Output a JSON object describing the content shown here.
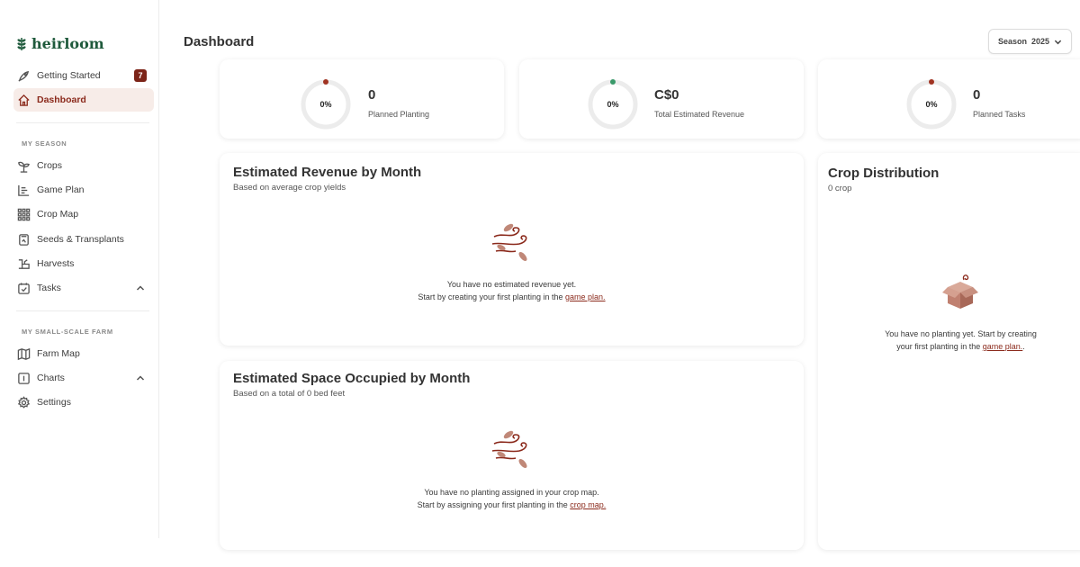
{
  "app": {
    "name": "heirloom"
  },
  "sidebar": {
    "getting_started": {
      "label": "Getting Started",
      "badge": "7"
    },
    "dashboard": {
      "label": "Dashboard"
    },
    "my_season_label": "MY SEASON",
    "season_items": [
      {
        "label": "Crops",
        "icon": "sprout-icon"
      },
      {
        "label": "Game Plan",
        "icon": "list-icon"
      },
      {
        "label": "Crop Map",
        "icon": "grid-icon"
      },
      {
        "label": "Seeds & Transplants",
        "icon": "seed-packet-icon"
      },
      {
        "label": "Harvests",
        "icon": "harvest-icon"
      },
      {
        "label": "Tasks",
        "icon": "calendar-check-icon"
      }
    ],
    "farm_label": "MY SMALL-SCALE FARM",
    "farm_items": [
      {
        "label": "Farm Map",
        "icon": "map-icon"
      },
      {
        "label": "Charts",
        "icon": "chart-icon"
      },
      {
        "label": "Settings",
        "icon": "gear-icon"
      }
    ]
  },
  "header": {
    "title": "Dashboard",
    "season_label": "Season",
    "season_value": "2025"
  },
  "stats": [
    {
      "percent": "0%",
      "value": "0",
      "label": "Planned Planting",
      "dot_color": "#a03322"
    },
    {
      "percent": "0%",
      "value": "C$0",
      "label": "Total Estimated Revenue",
      "dot_color": "#3a9a6a"
    },
    {
      "percent": "0%",
      "value": "0",
      "label": "Planned Tasks",
      "dot_color": "#a03322"
    }
  ],
  "revenue_card": {
    "title": "Estimated Revenue by Month",
    "subtitle": "Based on average crop yields",
    "empty_line1": "You have no estimated revenue yet.",
    "empty_line2_prefix": "Start by creating your first planting in the",
    "link": "game plan."
  },
  "space_card": {
    "title": "Estimated Space Occupied by Month",
    "subtitle": "Based on a total of 0 bed feet",
    "empty_line1": "You have no planting assigned in your crop map.",
    "empty_line2_prefix": "Start by assigning your first planting in the",
    "link": "crop map."
  },
  "distribution_card": {
    "title": "Crop Distribution",
    "subtitle": "0 crop",
    "empty_line1": "You have no planting yet. Start by creating",
    "empty_line2_prefix": "your first planting in the",
    "link": "game plan.",
    "trailing": "."
  },
  "colors": {
    "accent": "#8b2a1c",
    "brand_green": "#1f5a3c",
    "illustration": "#b9796a"
  }
}
